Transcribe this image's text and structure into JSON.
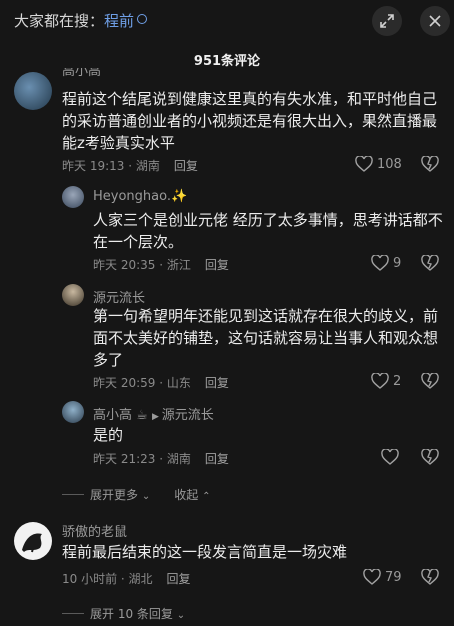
{
  "header": {
    "search_prefix": "大家都在搜：",
    "search_keyword": "程前",
    "comment_count": "951条评论"
  },
  "comments": [
    {
      "author": "高小高",
      "text": "程前这个结尾说到健康这里真的有失水准，和平时他自己的采访普通创业者的小视频还是有很大出入，果然直播最能z考验真实水平",
      "time": "昨天 19:13 · 湖南",
      "reply": "回复",
      "likes": "108"
    },
    {
      "author": "Heyonghao.",
      "text": "人家三个是创业元佬 经历了太多事情，思考讲话都不在一个层次。",
      "time": "昨天 20:35 · 浙江",
      "reply": "回复",
      "likes": "9"
    },
    {
      "author": "源元流长",
      "text": "第一句希望明年还能见到这话就存在很大的歧义，前面不太美好的铺垫，这句话就容易让当事人和观众想多了",
      "time": "昨天 20:59 · 山东",
      "reply": "回复",
      "likes": "2"
    },
    {
      "author": "高小高",
      "reply_to": "源元流长",
      "text": "是的",
      "time": "昨天 21:23 · 湖南",
      "reply": "回复"
    },
    {
      "author": "骄傲的老鼠",
      "text": "程前最后结束的这一段发言简直是一场灾难",
      "time": "10 小时前 · 湖北",
      "reply": "回复",
      "likes": "79"
    }
  ],
  "thread_controls": {
    "expand_more": "展开更多",
    "collapse": "收起",
    "expand_replies": "展开 10 条回复"
  }
}
